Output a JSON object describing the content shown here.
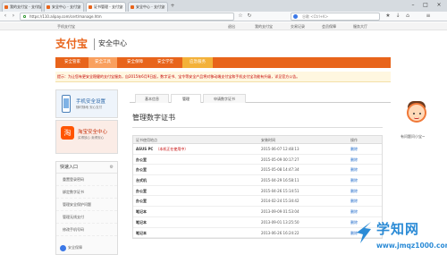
{
  "browser": {
    "tabs": [
      {
        "label": "我的支付宝 - 支付宝"
      },
      {
        "label": "安全中心 - 支付宝"
      },
      {
        "label": "证书管理 - 支付宝"
      },
      {
        "label": "安全中心 - 支付宝"
      }
    ],
    "active_tab": 2,
    "url": "https://110.alipay.com/cert/manage.htm",
    "search_placeholder": "谷歌 <Ctrl+K>",
    "new_tab_glyph": "+"
  },
  "sitebar": {
    "left": "手机支付宝",
    "links": [
      "退出",
      "我的支付宝",
      "交易记录",
      "会员保障",
      "服务大厅"
    ]
  },
  "header": {
    "logo": "支付宝",
    "section": "安全中心"
  },
  "nav": {
    "items": [
      "安全管家",
      "安全工具",
      "安全保障",
      "安全学堂",
      "应急服务"
    ],
    "active_index": 1,
    "beta_index": 4
  },
  "notice": "提示：为让您有更安全稳健的支付宝服务，自2015年6月9日起，数字证书、宝令等安全产品将对移动端支付宝和手机支付宝功能有升级，详见官方公告。",
  "sidebar": {
    "promo1": {
      "title": "手机安全设置",
      "sub": "随时随地 安心支付"
    },
    "promo2": {
      "title": "淘宝安全中心",
      "sub": "买得放心 卖得安心",
      "icon_char": "淘"
    },
    "quick_title": "快速入口",
    "quick_items": [
      "重置登录密码",
      "绑定数字证书",
      "管理安全保护问题",
      "管理无线支付",
      "修改手机号码"
    ],
    "footer": "安全保障"
  },
  "main": {
    "subtabs": [
      "基本信息",
      "管理",
      "申请数字证书"
    ],
    "active_subtab": 1,
    "title": "管理数字证书",
    "columns": [
      "证书使用地点",
      "安装时间",
      "操作"
    ],
    "current_tag": "（本机正在使用中）",
    "rows": [
      {
        "location": "ASUS PC",
        "current": true,
        "time": "2015-06-07 12:48:13",
        "action": "删除"
      },
      {
        "location": "办公室",
        "current": false,
        "time": "2015-05-09 00:17:27",
        "action": "删除"
      },
      {
        "location": "办公室",
        "current": false,
        "time": "2015-05-08 14:47:34",
        "action": "删除"
      },
      {
        "location": "台式机",
        "current": false,
        "time": "2015-04-29 16:58:11",
        "action": "删除"
      },
      {
        "location": "办公室",
        "current": false,
        "time": "2015-04-26 15:14:51",
        "action": "删除"
      },
      {
        "location": "办公室",
        "current": false,
        "time": "2014-02-24 15:34:42",
        "action": "删除"
      },
      {
        "location": "笔记本",
        "current": false,
        "time": "2013-09-09 01:53:04",
        "action": "删除"
      },
      {
        "location": "笔记本",
        "current": false,
        "time": "2013-09-01 13:25:50",
        "action": "删除"
      },
      {
        "location": "笔记本",
        "current": false,
        "time": "2013-06-26 16:24:22",
        "action": "删除"
      }
    ]
  },
  "helper": {
    "label": "有问题问小宝~"
  },
  "watermark": {
    "text": "学知网",
    "url": "www.jmqz1000.com"
  },
  "colors": {
    "brand": "#e8641b",
    "link": "#1a67c9",
    "alert": "#c40000",
    "watermark": "#2b8bd6"
  }
}
